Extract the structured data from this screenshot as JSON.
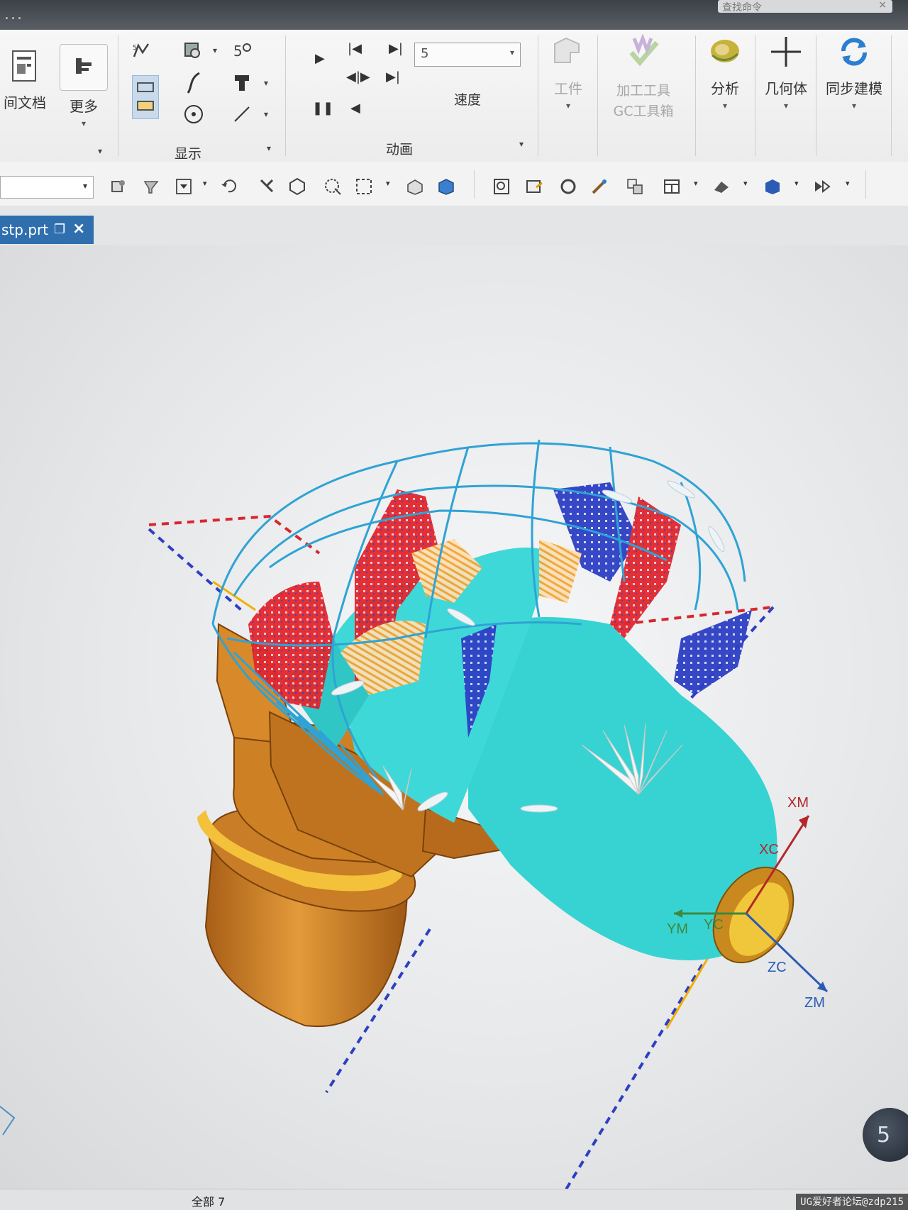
{
  "window": {
    "title": "...",
    "search_placeholder": "查找命令",
    "search_close": "×"
  },
  "ribbon": {
    "doc_button": "间文档",
    "more_button": "更多",
    "display_group": "显示",
    "animation_group": "动画",
    "speed_value": "5",
    "speed_label": "速度",
    "workpiece_button": "工件",
    "machining_tools_line1": "加工工具",
    "machining_tools_line2": "GC工具箱",
    "analysis_button": "分析",
    "geometry_button": "几何体",
    "sync_modeling_button": "同步建模"
  },
  "tab": {
    "name": "stp.prt",
    "close": "×"
  },
  "viewport": {
    "axes": {
      "xm": "XM",
      "xc": "XC",
      "ym": "YM",
      "yc": "YC",
      "zc": "ZC",
      "zm": "ZM"
    },
    "zoom_badge": "5"
  },
  "status": {
    "text": "全部 7"
  },
  "watermark": "UG爱好者论坛@zdp215",
  "colors": {
    "part_body": "#d98a2a",
    "toolpath_red": "#e3262d",
    "toolpath_blue": "#2d3fc4",
    "toolpath_cyan": "#2fb3d9",
    "cut_region": "#3ad6d6",
    "axis_red": "#b3262a",
    "axis_green": "#3c8a3c",
    "axis_blue": "#2a5bb5"
  }
}
